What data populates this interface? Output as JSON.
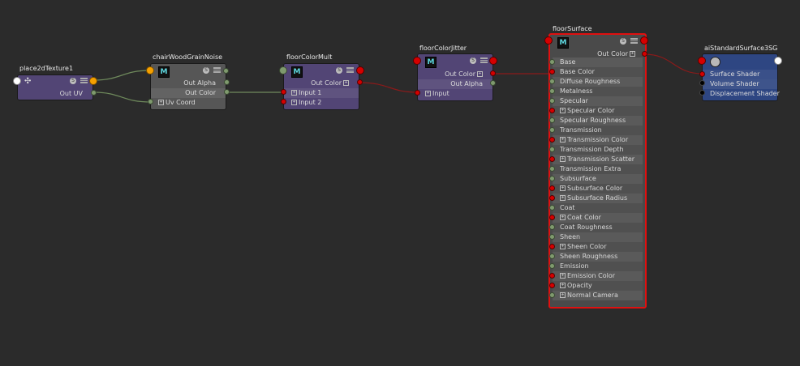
{
  "nodes": {
    "place2d": {
      "name": "place2dTexture1",
      "outputs": [
        "Out UV"
      ]
    },
    "noise": {
      "name": "chairWoodGrainNoise",
      "outputs": [
        "Out Alpha",
        "Out Color"
      ],
      "inputs": [
        "Uv Coord"
      ]
    },
    "mult": {
      "name": "floorColorMult",
      "outputs": [
        "Out Color"
      ],
      "inputs": [
        "Input 1",
        "Input 2"
      ]
    },
    "jitter": {
      "name": "floorColorJitter",
      "outputs": [
        "Out Color",
        "Out Alpha"
      ],
      "inputs": [
        "Input"
      ]
    },
    "surface": {
      "name": "floorSurface",
      "output": "Out Color",
      "attributes": [
        "Base",
        "Base Color",
        "Diffuse Roughness",
        "Metalness",
        "Specular",
        "Specular Color",
        "Specular Roughness",
        "Transmission",
        "Transmission Color",
        "Transmission Depth",
        "Transmission Scatter",
        "Transmission Extra Roughness",
        "Subsurface",
        "Subsurface Color",
        "Subsurface Radius",
        "Coat",
        "Coat Color",
        "Coat Roughness",
        "Sheen",
        "Sheen Color",
        "Sheen Roughness",
        "Emission",
        "Emission Color",
        "Opacity",
        "Normal Camera"
      ]
    },
    "sg": {
      "name": "aiStandardSurface3SG",
      "inputs": [
        "Surface Shader",
        "Volume Shader",
        "Displacement Shader"
      ]
    }
  },
  "icons": {
    "maya": "M",
    "swatch": "S"
  },
  "colors": {
    "background": "#2b2b2b",
    "selected_border": "#e01010",
    "wire_red": "#8b1a1a",
    "wire_green": "#6f8a5c"
  }
}
